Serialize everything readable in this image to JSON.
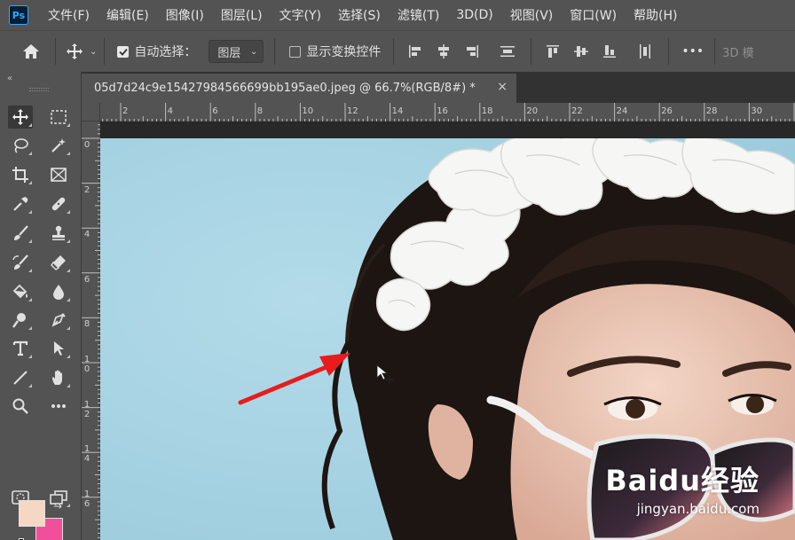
{
  "app": {
    "logo": "Ps"
  },
  "menu": [
    "文件(F)",
    "编辑(E)",
    "图像(I)",
    "图层(L)",
    "文字(Y)",
    "选择(S)",
    "滤镜(T)",
    "3D(D)",
    "视图(V)",
    "窗口(W)",
    "帮助(H)"
  ],
  "options": {
    "auto_select_label": "自动选择：",
    "auto_select_checked": true,
    "layer_dropdown": "图层",
    "show_transform_label": "显示变换控件",
    "show_transform_checked": false,
    "more": "•••",
    "mode_3d": "3D 模"
  },
  "document": {
    "tab_title": "05d7d24c9e15427984566699bb195ae0.jpeg @ 66.7%(RGB/8#) *",
    "close": "×"
  },
  "ruler": {
    "top": [
      "2",
      "4",
      "6",
      "8",
      "10",
      "12",
      "14",
      "16",
      "18",
      "20",
      "22",
      "24",
      "26",
      "28",
      "30"
    ],
    "left": [
      "0",
      "2",
      "4",
      "6",
      "8",
      "0",
      "2",
      "4",
      "6"
    ],
    "left_prefix": [
      "",
      "",
      "",
      "",
      "",
      "1",
      "1",
      "1",
      "1"
    ]
  },
  "colors": {
    "foreground": "#f6d7c4",
    "background": "#f24f9a",
    "sky": "#a7d3e3",
    "arrow": "#e81c1c"
  },
  "watermark": {
    "logo": "Baidu经验",
    "url": "jingyan.baidu.com"
  }
}
